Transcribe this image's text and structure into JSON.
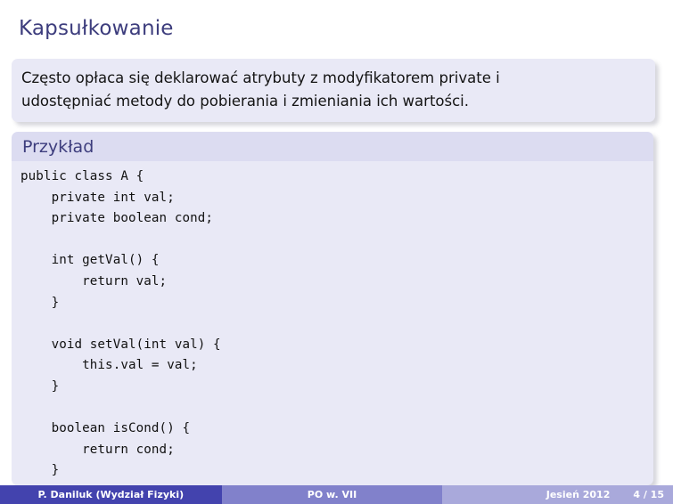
{
  "slide": {
    "title": "Kapsułkowanie"
  },
  "text_block": {
    "lines": [
      "Często opłaca się deklarować atrybuty z modyfikatorem private i",
      "udostępniać metody do pobierania i zmieniania ich wartości."
    ]
  },
  "example_block": {
    "heading": "Przykład",
    "code": "public class A {\n    private int val;\n    private boolean cond;\n\n    int getVal() {\n        return val;\n    }\n\n    void setVal(int val) {\n        this.val = val;\n    }\n\n    boolean isCond() {\n        return cond;\n    }\n}"
  },
  "footer": {
    "author": "P. Daniluk  (Wydział Fizyki)",
    "course": "PO w. VII",
    "term": "Jesień 2012",
    "page": "4 / 15"
  },
  "colors": {
    "title_blue": "#3d3d7d",
    "block_bg": "#e9e9f6",
    "block_head_bg": "#dcdcf1",
    "footer_dark": "#4343ae",
    "footer_mid": "#8181cb",
    "footer_light": "#a9a9db"
  }
}
